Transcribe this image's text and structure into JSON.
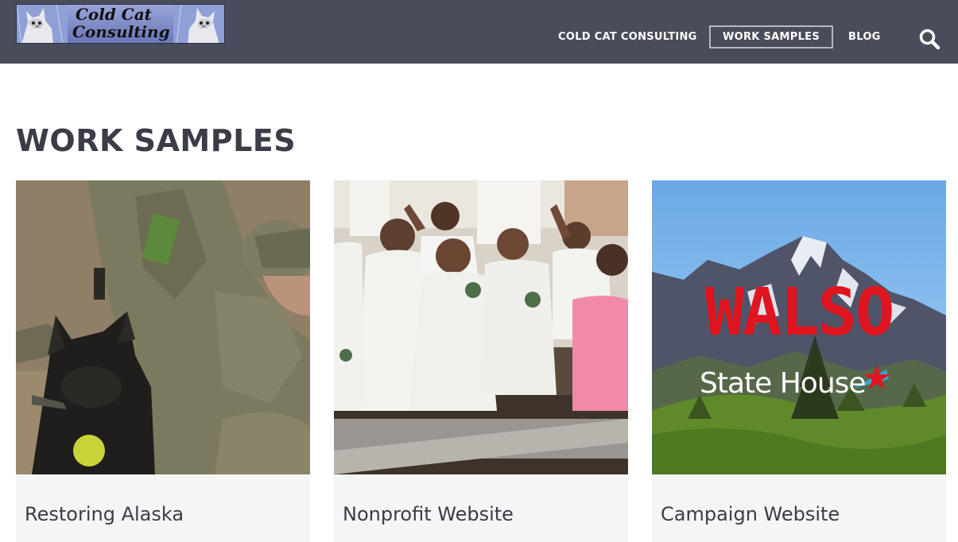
{
  "header": {
    "logo": {
      "line1": "Cold Cat",
      "line2": "Consulting"
    },
    "nav": [
      {
        "label": "COLD CAT CONSULTING"
      },
      {
        "label": "WORK SAMPLES",
        "active": true
      },
      {
        "label": "BLOG"
      }
    ],
    "search_icon": "search-icon"
  },
  "main": {
    "title": "WORK SAMPLES",
    "cards": [
      {
        "title": "Restoring Alaska"
      },
      {
        "title": "Nonprofit Website"
      },
      {
        "title": "Campaign Website",
        "image_text": {
          "headline": "WALSO",
          "subline": "State House"
        }
      }
    ]
  },
  "colors": {
    "header_bg": "#494c5a",
    "text": "#3a3d47",
    "card_bg": "#f5f5f5",
    "campaign_red": "#e0151f"
  }
}
